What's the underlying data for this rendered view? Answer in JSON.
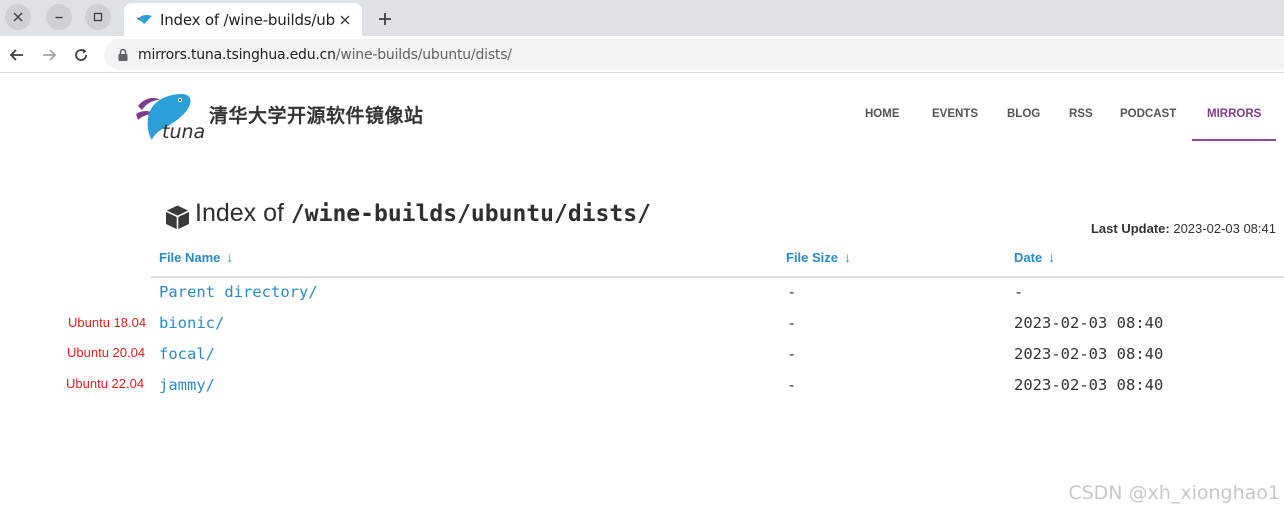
{
  "browser": {
    "tab_title": "Index of /wine-builds/ubuntu/dists/",
    "url_host": "mirrors.tuna.tsinghua.edu.cn",
    "url_path": "/wine-builds/ubuntu/dists/"
  },
  "site": {
    "name": "清华大学开源软件镜像站",
    "logo_text": "tuna",
    "nav": [
      {
        "label": "HOME"
      },
      {
        "label": "EVENTS"
      },
      {
        "label": "BLOG"
      },
      {
        "label": "RSS"
      },
      {
        "label": "PODCAST"
      },
      {
        "label": "MIRRORS",
        "active": true
      }
    ],
    "accent_color": "#7f3c8d"
  },
  "index": {
    "title_label": "Index of",
    "title_path": "/wine-builds/ubuntu/dists/",
    "last_update_label": "Last Update:",
    "last_update_value": "2023-02-03 08:41",
    "columns": [
      {
        "label": "File Name",
        "sort_icon": "↓"
      },
      {
        "label": "File Size",
        "sort_icon": "↓"
      },
      {
        "label": "Date",
        "sort_icon": "↓"
      }
    ],
    "rows": [
      {
        "name": "Parent directory/",
        "size": "-",
        "date": "-",
        "annotation": ""
      },
      {
        "name": "bionic/",
        "size": "-",
        "date": "2023-02-03 08:40",
        "annotation": "Ubuntu 18.04"
      },
      {
        "name": "focal/",
        "size": "-",
        "date": "2023-02-03 08:40",
        "annotation": "Ubuntu 20.04"
      },
      {
        "name": "jammy/",
        "size": "-",
        "date": "2023-02-03 08:40",
        "annotation": "Ubuntu 22.04"
      }
    ],
    "link_color": "#2a8ac9",
    "annotation_color": "#e02020"
  },
  "watermark": "CSDN @xh_xionghao1"
}
